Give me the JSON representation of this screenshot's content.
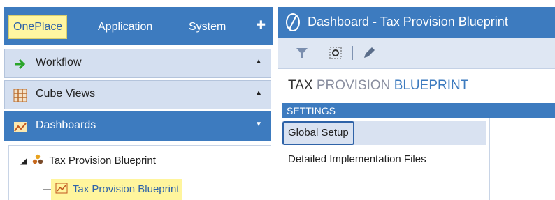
{
  "left_panel": {
    "tabs": [
      {
        "label": "OnePlace",
        "active": true
      },
      {
        "label": "Application",
        "active": false
      },
      {
        "label": "System",
        "active": false
      }
    ],
    "pin_icon": "pin-icon",
    "accordions": [
      {
        "label": "Workflow",
        "icon": "arrow-right-icon",
        "caret": "▲"
      },
      {
        "label": "Cube Views",
        "icon": "grid-icon",
        "caret": "▲"
      },
      {
        "label": "Dashboards",
        "icon": "chart-icon",
        "caret": "▼",
        "active": true
      }
    ],
    "tree": {
      "parent_label": "Tax Provision Blueprint",
      "child_label": "Tax Provision Blueprint"
    }
  },
  "right_panel": {
    "title": "Dashboard - Tax Provision Blueprint",
    "heading": {
      "word1": "TAX",
      "word2": "PROVISION",
      "word3": "BLUEPRINT"
    },
    "section": "SETTINGS",
    "items": [
      {
        "label": "Global Setup",
        "selected": true
      },
      {
        "label": "Detailed Implementation Files",
        "selected": false
      }
    ]
  },
  "colors": {
    "accent": "#3d7bbf",
    "highlight": "#fff59d"
  }
}
